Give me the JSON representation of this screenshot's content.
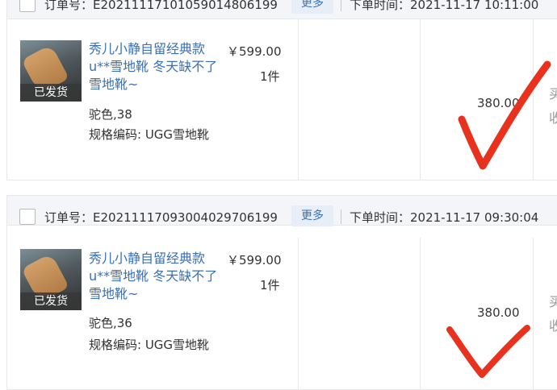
{
  "orders": [
    {
      "order_no": "订单号：E20211117101059014806199",
      "more_label": "更多",
      "order_time": "下单时间：2021-11-17 10:11:00",
      "shipping_badge": "已发货",
      "product_title": "秀儿小静自留经典款u**雪地靴 冬天缺不了雪地靴~",
      "variant": "驼色,38",
      "sku_code": "规格编码: UGG雪地靴",
      "price": "￥599.00",
      "quantity": "1件",
      "amount": "380.00",
      "side_text_1": "买",
      "side_text_2": "收"
    },
    {
      "order_no": "订单号：E20211117093004029706199",
      "more_label": "更多",
      "order_time": "下单时间：2021-11-17 09:30:04",
      "shipping_badge": "已发货",
      "product_title": "秀儿小静自留经典款u**雪地靴 冬天缺不了雪地靴~",
      "variant": "驼色,36",
      "sku_code": "规格编码: UGG雪地靴",
      "price": "￥599.00",
      "quantity": "1件",
      "amount": "380.00",
      "side_text_1": "买",
      "side_text_2": "收"
    }
  ],
  "colors": {
    "link": "#3a6fb5",
    "header_bg": "#f3f5f8",
    "annotation": "#e8321e"
  }
}
